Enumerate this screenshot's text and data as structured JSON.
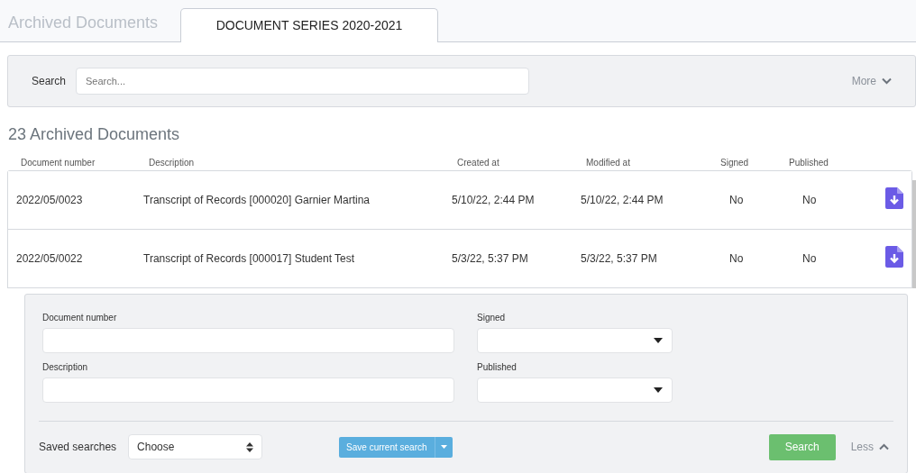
{
  "header": {
    "title": "Archived Documents",
    "tabs": [
      {
        "label": "DOCUMENT SERIES 2020-2021",
        "selected": true
      }
    ]
  },
  "search_bar": {
    "label": "Search",
    "placeholder": "Search...",
    "toggle": "More"
  },
  "heading": "23 Archived Documents",
  "table": {
    "columns": [
      "Document number",
      "Description",
      "Created at",
      "Modified at",
      "Signed",
      "Published"
    ],
    "rows": [
      {
        "cells": [
          "2022/05/0023",
          "Transcript of Records [000020] Garnier Martina",
          "5/10/22, 2:44 PM",
          "5/10/22, 2:44 PM",
          "No",
          "No"
        ]
      },
      {
        "cells": [
          "2022/05/0022",
          "Transcript of Records [000017] Student Test",
          "5/3/22, 5:37 PM",
          "5/3/22, 5:37 PM",
          "No",
          "No"
        ]
      }
    ]
  },
  "advanced_search": {
    "fields": [
      {
        "label": "Document number",
        "kind": "text"
      },
      {
        "label": "Signed",
        "kind": "select"
      },
      {
        "label": "Description",
        "kind": "text"
      },
      {
        "label": "Published",
        "kind": "select"
      }
    ],
    "saved_searches_label": "Saved searches",
    "saved_searches_value": "Choose",
    "save_button": "Save current search",
    "search_button": "Search",
    "toggle": "Less"
  }
}
